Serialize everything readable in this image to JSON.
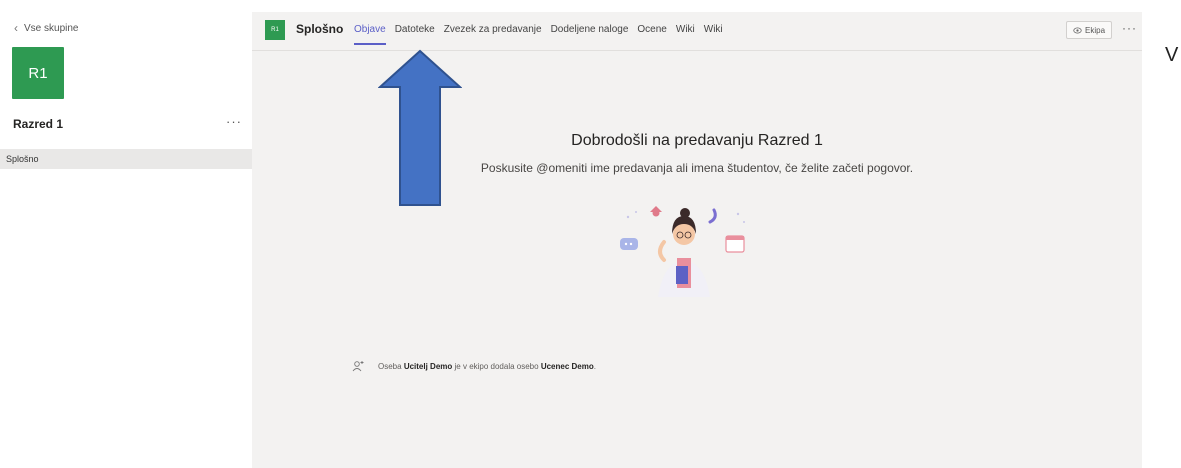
{
  "sidebar": {
    "back_label": "Vse skupine",
    "team_initials": "R1",
    "team_name": "Razred 1",
    "more": "···",
    "channels": [
      {
        "label": "Splošno"
      }
    ]
  },
  "header": {
    "channel_initials": "R1",
    "channel_title": "Splošno",
    "tabs": [
      {
        "label": "Objave",
        "active": true
      },
      {
        "label": "Datoteke"
      },
      {
        "label": "Zvezek za predavanje"
      },
      {
        "label": "Dodeljene naloge"
      },
      {
        "label": "Ocene"
      },
      {
        "label": "Wiki"
      },
      {
        "label": "Wiki"
      }
    ],
    "team_button": "Ekipa",
    "more": "···"
  },
  "welcome": {
    "title": "Dobrodošli na predavanju Razred 1",
    "subtitle": "Poskusite @omeniti ime predavanja ali imena študentov, če želite začeti pogovor."
  },
  "activity": {
    "prefix": "Oseba",
    "actor": "Ucitelj Demo",
    "middle": "je v ekipo dodala osebo",
    "target": "Ucenec Demo",
    "suffix": "."
  },
  "annotation": {
    "side_letter": "V",
    "arrow_color": "#4472c4"
  }
}
